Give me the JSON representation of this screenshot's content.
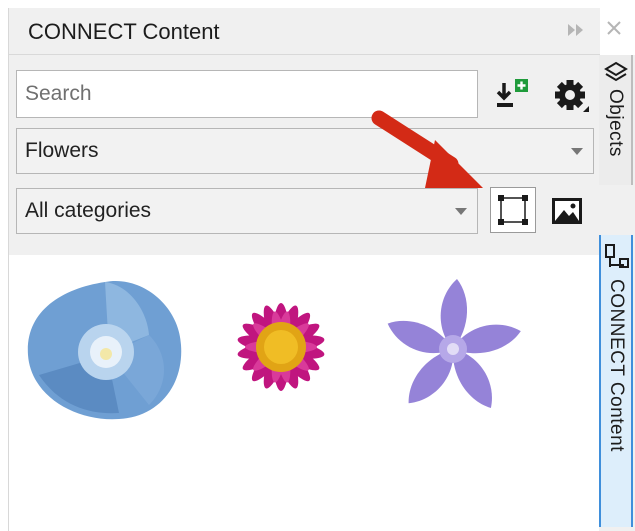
{
  "panel": {
    "title": "CONNECT Content",
    "search_placeholder": "Search",
    "collection_value": "Flowers",
    "category_value": "All categories"
  },
  "side_tabs": {
    "objects_label": "Objects",
    "connect_label": "CONNECT Content"
  },
  "content": {
    "thumbnails": [
      {
        "name": "blue morning glory"
      },
      {
        "name": "magenta aster"
      },
      {
        "name": "purple periwinkle"
      }
    ]
  },
  "colors": {
    "annotation_arrow": "#d32a16",
    "active_tab_border": "#3f8fdb",
    "active_tab_fill": "#ddeefb"
  },
  "icons": [
    "expand-panel-icon",
    "close-icon",
    "import-icon",
    "settings-icon",
    "caret-down-icon",
    "bounding-box-icon",
    "image-icon",
    "objects-layers-icon",
    "connect-content-icon"
  ]
}
